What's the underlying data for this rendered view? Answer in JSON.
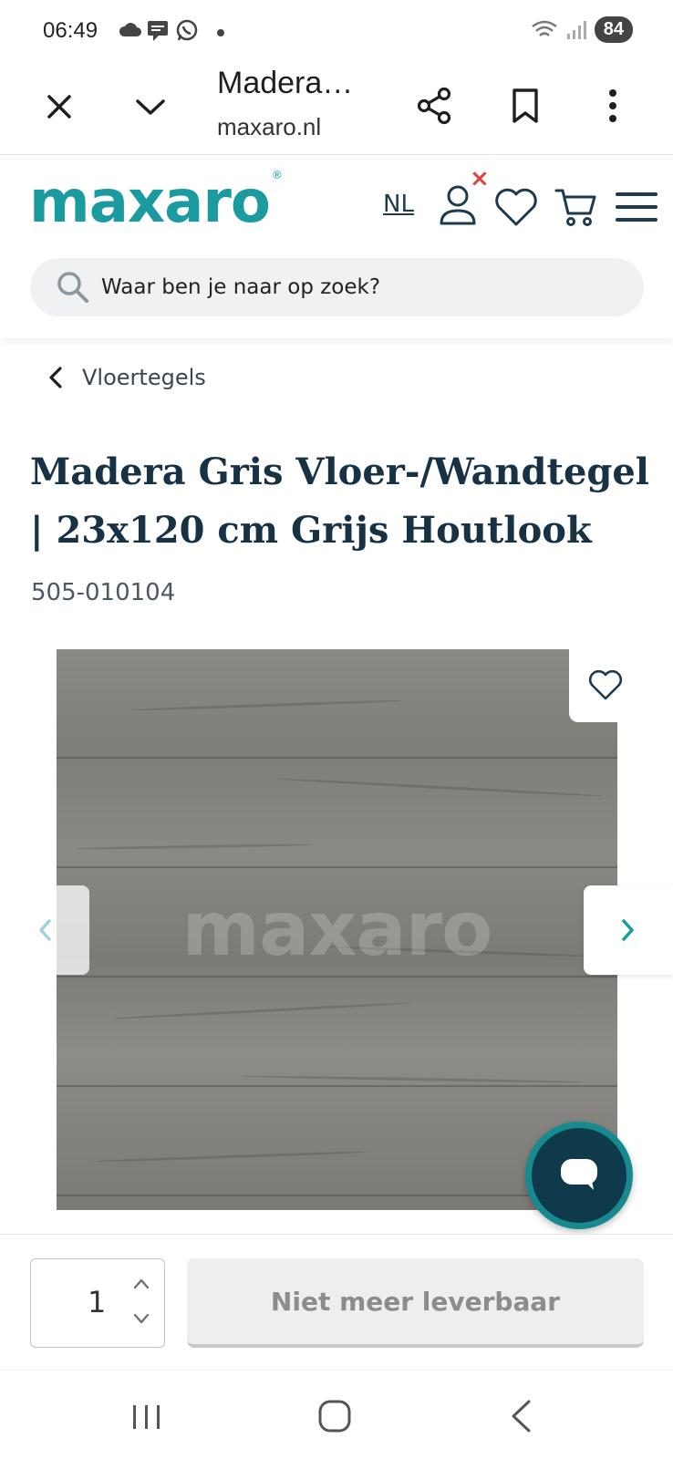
{
  "status_bar": {
    "time": "06:49",
    "battery": "84"
  },
  "browser": {
    "page_title": "Madera…",
    "url": "maxaro.nl"
  },
  "header": {
    "logo_text": "maxaro",
    "logo_mark": "®",
    "language": "NL",
    "search_placeholder": "Waar ben je naar op zoek?",
    "brand_color": "#1b9aa0",
    "notification_mark": "×"
  },
  "breadcrumb": {
    "label": "Vloertegels"
  },
  "product": {
    "title": "Madera Gris Vloer-/Wandtegel | 23x120 cm Grijs Houtlook",
    "sku": "505-010104",
    "image_watermark": "maxaro"
  },
  "purchase": {
    "quantity": "1",
    "button_label": "Niet meer leverbaar"
  },
  "icons": {
    "close": "close-icon",
    "minimize": "chevron-down-icon",
    "share": "share-icon",
    "bookmark": "bookmark-icon",
    "more": "more-vert-icon",
    "user": "user-icon",
    "wishlist": "heart-icon",
    "cart": "cart-icon",
    "menu": "hamburger-icon",
    "search": "search-icon",
    "chat": "chat-icon"
  }
}
